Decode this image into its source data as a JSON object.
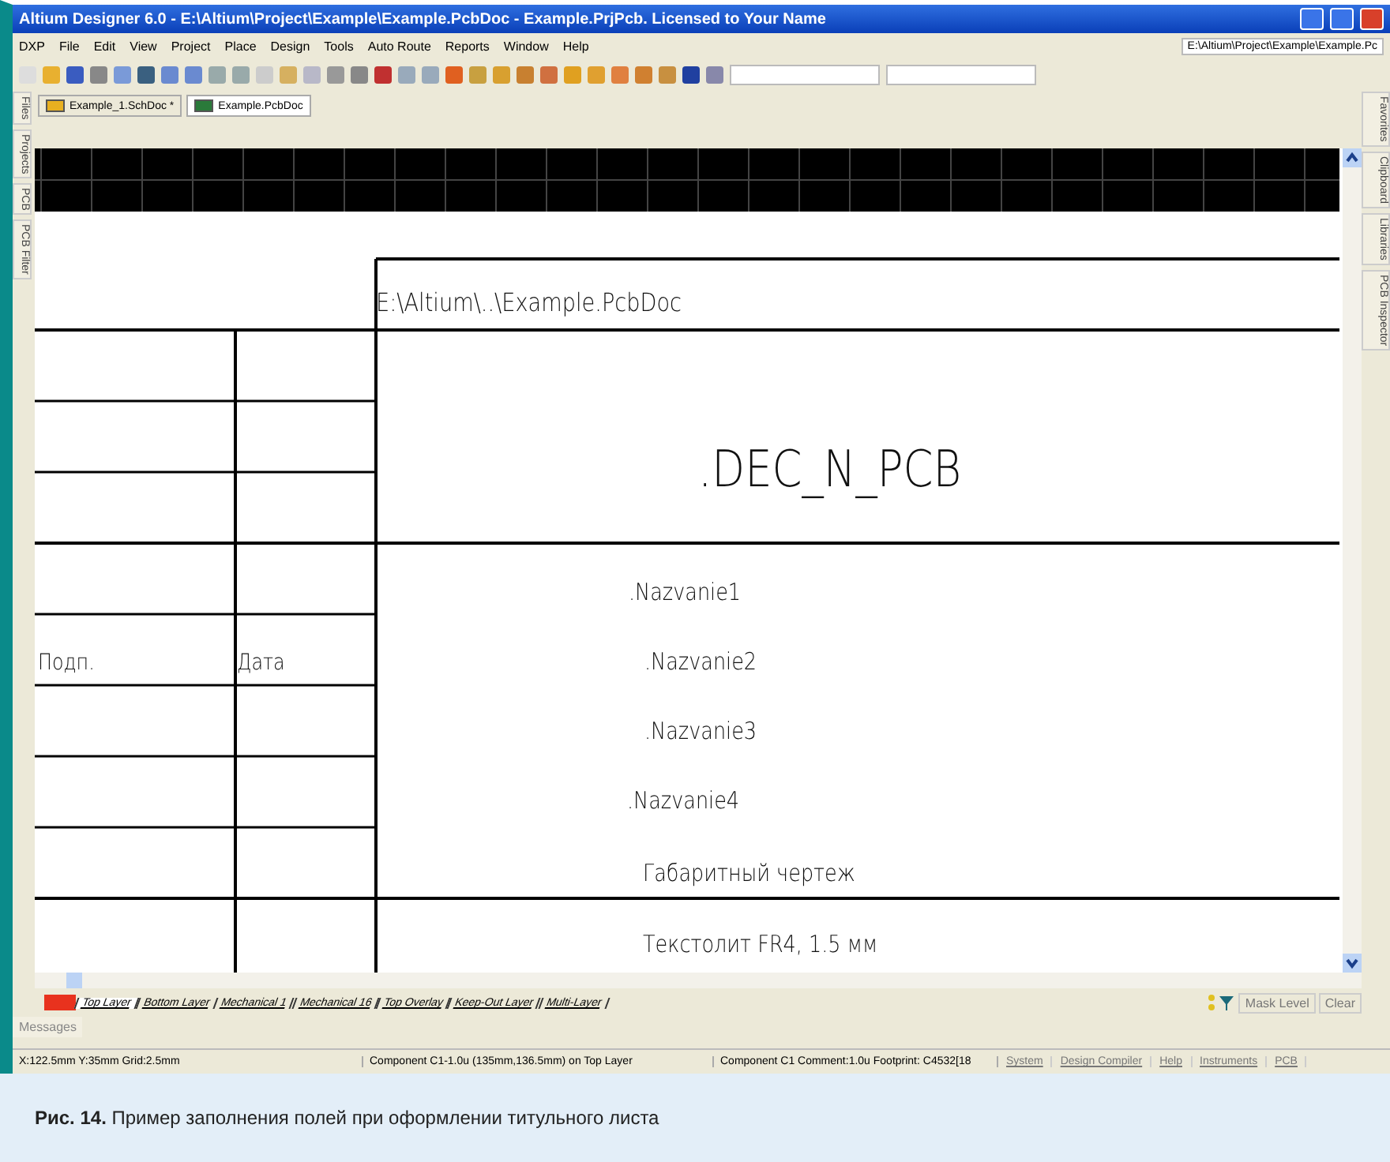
{
  "window": {
    "title": "Altium Designer 6.0 - E:\\Altium\\Project\\Example\\Example.PcbDoc - Example.PrjPcb. Licensed to Your Name"
  },
  "menu": [
    "DXP",
    "File",
    "Edit",
    "View",
    "Project",
    "Place",
    "Design",
    "Tools",
    "Auto Route",
    "Reports",
    "Window",
    "Help"
  ],
  "path_combo": {
    "value": "E:\\Altium\\Project\\Example\\Example.Pc"
  },
  "doc_tabs": [
    {
      "label": "Example_1.SchDoc *",
      "kind": "sch",
      "selected": false
    },
    {
      "label": "Example.PcbDoc",
      "kind": "pcb",
      "selected": true
    }
  ],
  "left_panel_tabs": [
    "Files",
    "Projects",
    "PCB",
    "PCB Filter"
  ],
  "right_panel_tabs": [
    "Favorites",
    "Clipboard",
    "Libraries",
    "PCB Inspector"
  ],
  "drawing": {
    "file_path": "E:\\Altium\\..\\Example.PcbDoc",
    "designation": ".DEC_N_PCB",
    "names": [
      ".Nazvanie1",
      ".Nazvanie2",
      ".Nazvanie3",
      ".Nazvanie4"
    ],
    "drawing_type": "Габаритный чертеж",
    "material": "Текстолит FR4, 1.5 мм",
    "signature_label": "Подп.",
    "date_label": "Дата"
  },
  "current_layer": {
    "color": "#e8321e"
  },
  "layer_tabs": [
    {
      "label": "Top Layer",
      "selected": true
    },
    {
      "label": "Bottom Layer",
      "selected": false
    },
    {
      "label": "Mechanical 1",
      "selected": false
    },
    {
      "label": "Mechanical 16",
      "selected": false
    },
    {
      "label": "Top Overlay",
      "selected": false
    },
    {
      "label": "Keep-Out Layer",
      "selected": false
    },
    {
      "label": "Multi-Layer",
      "selected": false
    }
  ],
  "mask_level": "Mask Level",
  "clear": "Clear",
  "messages_tab": "Messages",
  "status_bar": {
    "position": "X:122.5mm Y:35mm   Grid:2.5mm",
    "component": "Component C1-1.0u (135mm,136.5mm) on Top Layer",
    "details": "Component C1 Comment:1.0u Footprint: C4532[18",
    "buttons": [
      "System",
      "Design Compiler",
      "Help",
      "Instruments",
      "PCB"
    ]
  },
  "caption": "**Рис. 14.** Пример заполнения полей при оформлении титульного листа"
}
